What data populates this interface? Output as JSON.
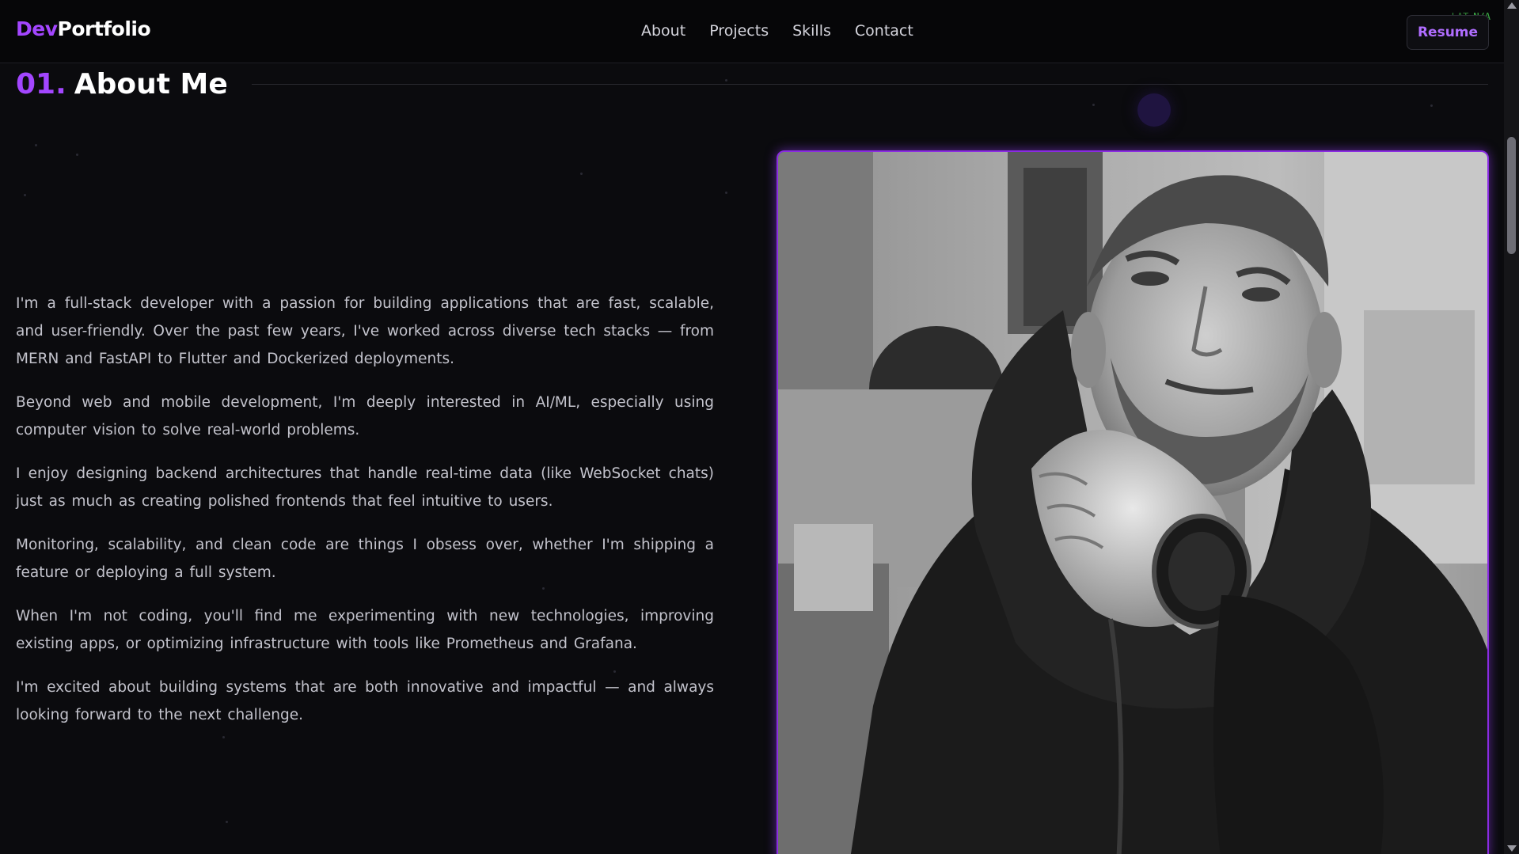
{
  "nav": {
    "logo_accent": "Dev",
    "logo_rest": "Portfolio",
    "links": [
      "About",
      "Projects",
      "Skills",
      "Contact"
    ],
    "resume_label": "Resume",
    "lat_label": "LAT",
    "lat_value": "N/A"
  },
  "section": {
    "number": "01.",
    "title": "About Me"
  },
  "about": {
    "paragraphs": [
      "I'm a full-stack developer with a passion for building applications that are fast, scalable, and user-friendly. Over the past few years, I've worked across diverse tech stacks — from MERN and FastAPI to Flutter and Dockerized deployments.",
      "Beyond web and mobile development, I'm deeply interested in AI/ML, especially using computer vision to solve real-world problems.",
      "I enjoy designing backend architectures that handle real-time data (like WebSocket chats) just as much as creating polished frontends that feel intuitive to users.",
      "Monitoring, scalability, and clean code are things I obsess over, whether I'm shipping a feature or deploying a full system.",
      "When I'm not coding, you'll find me experimenting with new technologies, improving existing apps, or optimizing infrastructure with tools like Prometheus and Grafana.",
      "I'm excited about building systems that are both innovative and impactful — and always looking forward to the next challenge."
    ]
  },
  "colors": {
    "accent": "#a346ff",
    "background": "#0b0b0e",
    "frame": "#8a2be2",
    "latency": "#3fb44a"
  },
  "icons": {
    "scroll_up": "chevron-up-icon",
    "scroll_down": "chevron-down-icon"
  }
}
